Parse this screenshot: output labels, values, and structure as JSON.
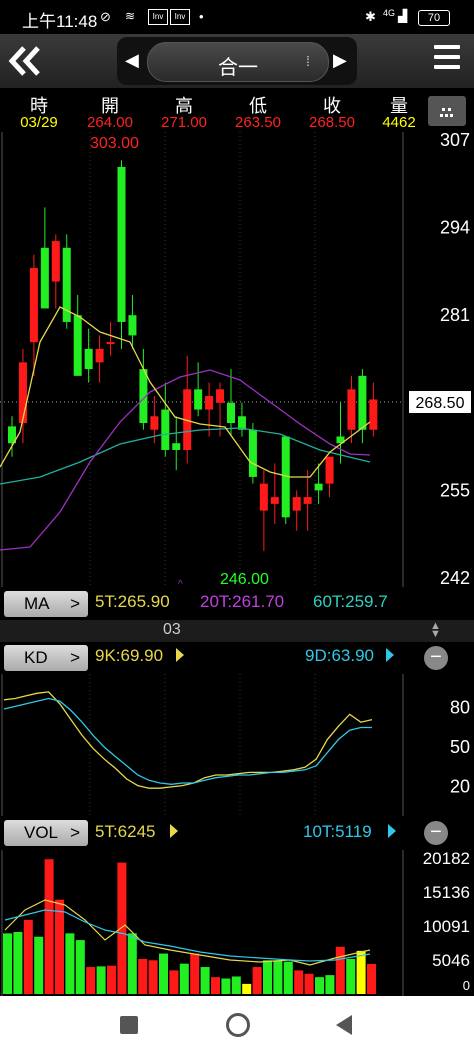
{
  "status_bar": {
    "time": "上午11:48",
    "network": "4G",
    "battery": "70"
  },
  "header": {
    "stock_name": "合一",
    "back_icon": "double-chevron-left-icon",
    "menu_icon": "hamburger-menu-icon"
  },
  "quote": {
    "labels": [
      "時",
      "開",
      "高",
      "低",
      "收",
      "量"
    ],
    "values": [
      "03/29",
      "264.00",
      "271.00",
      "263.50",
      "268.50",
      "4462"
    ]
  },
  "main_chart": {
    "price_ticks": [
      "307",
      "294",
      "281",
      "268.50",
      "255",
      "242"
    ],
    "high_label": "303.00",
    "low_label": "246.00",
    "current_price": "268.50",
    "month_label": "03"
  },
  "ma": {
    "label": "MA",
    "ma5": "5T:265.90",
    "ma20": "20T:261.70",
    "ma60": "60T:259.7"
  },
  "kd": {
    "label": "KD",
    "k": "9K:69.90",
    "d": "9D:63.90",
    "ticks": [
      "80",
      "50",
      "20"
    ]
  },
  "vol": {
    "label": "VOL",
    "v5": "5T:6245",
    "v10": "10T:5119",
    "ticks": [
      "20182",
      "15136",
      "10091",
      "5046",
      "0"
    ]
  },
  "chart_data": [
    {
      "type": "candlestick",
      "ylim": [
        242,
        307
      ],
      "ticks": [
        307,
        294,
        281,
        268.5,
        255,
        242
      ],
      "candles": [
        {
          "o": 262,
          "h": 266,
          "l": 260,
          "c": 264.5,
          "color": "green"
        },
        {
          "o": 265,
          "h": 276,
          "l": 262,
          "c": 274,
          "color": "red"
        },
        {
          "o": 277,
          "h": 290,
          "l": 272,
          "c": 288,
          "color": "red"
        },
        {
          "o": 291,
          "h": 297,
          "l": 284,
          "c": 282,
          "color": "green"
        },
        {
          "o": 286,
          "h": 293,
          "l": 282,
          "c": 292,
          "color": "red"
        },
        {
          "o": 291,
          "h": 293,
          "l": 279,
          "c": 280,
          "color": "green"
        },
        {
          "o": 281,
          "h": 284,
          "l": 272,
          "c": 272,
          "color": "green"
        },
        {
          "o": 276,
          "h": 279,
          "l": 271,
          "c": 273,
          "color": "green"
        },
        {
          "o": 274,
          "h": 278,
          "l": 271,
          "c": 276,
          "color": "red"
        },
        {
          "o": 277,
          "h": 280,
          "l": 275,
          "c": 277,
          "color": "red"
        },
        {
          "o": 280,
          "h": 304,
          "l": 276,
          "c": 303,
          "color": "green"
        },
        {
          "o": 281,
          "h": 284,
          "l": 276,
          "c": 278,
          "color": "green"
        },
        {
          "o": 273,
          "h": 276,
          "l": 264,
          "c": 265,
          "color": "green"
        },
        {
          "o": 266,
          "h": 269,
          "l": 262,
          "c": 264,
          "color": "red"
        },
        {
          "o": 267,
          "h": 271,
          "l": 260,
          "c": 261,
          "color": "green"
        },
        {
          "o": 261,
          "h": 266,
          "l": 258,
          "c": 262,
          "color": "green"
        },
        {
          "o": 261,
          "h": 275,
          "l": 259,
          "c": 270,
          "color": "red"
        },
        {
          "o": 270,
          "h": 274,
          "l": 266,
          "c": 267,
          "color": "green"
        },
        {
          "o": 269,
          "h": 271,
          "l": 263,
          "c": 267,
          "color": "red"
        },
        {
          "o": 270,
          "h": 271,
          "l": 263,
          "c": 268,
          "color": "red"
        },
        {
          "o": 268,
          "h": 273,
          "l": 263,
          "c": 265,
          "color": "green"
        },
        {
          "o": 266,
          "h": 268,
          "l": 263,
          "c": 264,
          "color": "green"
        },
        {
          "o": 264,
          "h": 265,
          "l": 256,
          "c": 257,
          "color": "green"
        },
        {
          "o": 256,
          "h": 258,
          "l": 246,
          "c": 252,
          "color": "red"
        },
        {
          "o": 254,
          "h": 259,
          "l": 250,
          "c": 253,
          "color": "red"
        },
        {
          "o": 251,
          "h": 263,
          "l": 250,
          "c": 263,
          "color": "green"
        },
        {
          "o": 252,
          "h": 255,
          "l": 249,
          "c": 254,
          "color": "red"
        },
        {
          "o": 253,
          "h": 258,
          "l": 249,
          "c": 254,
          "color": "red"
        },
        {
          "o": 255,
          "h": 259,
          "l": 253,
          "c": 256,
          "color": "green"
        },
        {
          "o": 256,
          "h": 260,
          "l": 254,
          "c": 260,
          "color": "red"
        },
        {
          "o": 262,
          "h": 268,
          "l": 259,
          "c": 263,
          "color": "green"
        },
        {
          "o": 264,
          "h": 272,
          "l": 262,
          "c": 270,
          "color": "red"
        },
        {
          "o": 264,
          "h": 273,
          "l": 262,
          "c": 272,
          "color": "green"
        },
        {
          "o": 264,
          "h": 271,
          "l": 263,
          "c": 268.5,
          "color": "red"
        }
      ]
    },
    {
      "type": "line",
      "ylim": [
        0,
        100
      ],
      "ticks": [
        80,
        50,
        20
      ],
      "series": [
        {
          "name": "9K",
          "values": [
            85,
            86,
            88,
            90,
            91,
            82,
            70,
            58,
            48,
            40,
            33,
            25,
            20,
            18,
            18,
            19,
            20,
            22,
            26,
            28,
            28,
            29,
            30,
            30,
            30,
            31,
            32,
            34,
            40,
            55,
            65,
            74,
            68,
            70
          ]
        },
        {
          "name": "9D",
          "values": [
            78,
            80,
            82,
            84,
            86,
            84,
            77,
            68,
            58,
            49,
            42,
            35,
            28,
            24,
            22,
            21,
            22,
            22,
            24,
            26,
            27,
            28,
            28,
            29,
            30,
            30,
            31,
            32,
            35,
            45,
            55,
            62,
            64,
            64
          ]
        }
      ]
    },
    {
      "type": "bar",
      "ylim": [
        0,
        20182
      ],
      "ticks": [
        20182,
        15136,
        10091,
        5046,
        0
      ],
      "values": [
        9000,
        9200,
        11000,
        8500,
        20000,
        14000,
        9000,
        8000,
        4000,
        4100,
        4200,
        19500,
        9000,
        5200,
        5000,
        6000,
        3500,
        4500,
        6000,
        4000,
        2500,
        2300,
        2600,
        1500,
        4000,
        5000,
        5000,
        4800,
        3500,
        3000,
        2500,
        2800,
        7000,
        5200,
        6400,
        4462
      ],
      "colors": [
        "green",
        "green",
        "red",
        "green",
        "red",
        "red",
        "green",
        "green",
        "red",
        "green",
        "red",
        "red",
        "green",
        "red",
        "red",
        "green",
        "red",
        "green",
        "red",
        "green",
        "red",
        "green",
        "green",
        "yellow",
        "red",
        "green",
        "green",
        "green",
        "red",
        "red",
        "green",
        "green",
        "red",
        "green",
        "yellow",
        "red"
      ]
    }
  ]
}
